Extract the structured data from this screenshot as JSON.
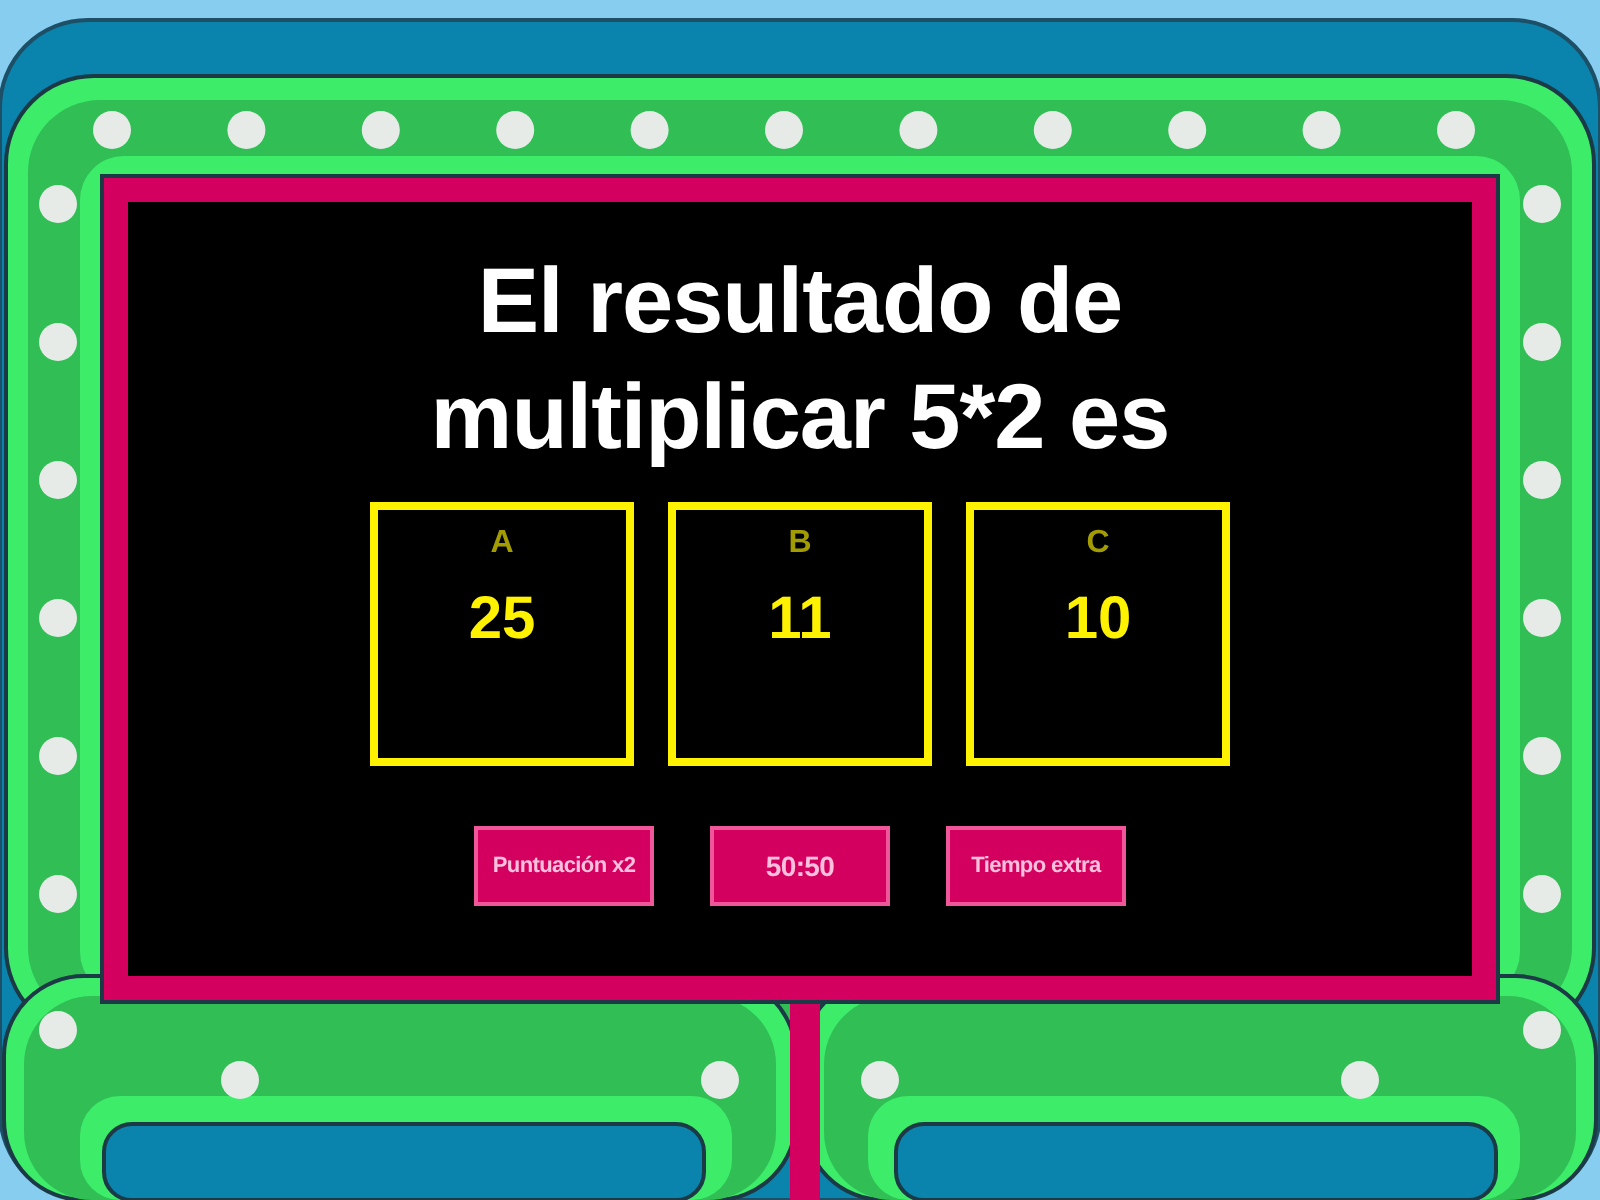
{
  "question": "El resultado de multiplicar 5*2 es",
  "answers": [
    {
      "letter": "A",
      "text": "25"
    },
    {
      "letter": "B",
      "text": "11"
    },
    {
      "letter": "C",
      "text": "10"
    }
  ],
  "powerups": [
    {
      "label": "Puntuación x2"
    },
    {
      "label": "50:50"
    },
    {
      "label": "Tiempo extra"
    }
  ]
}
